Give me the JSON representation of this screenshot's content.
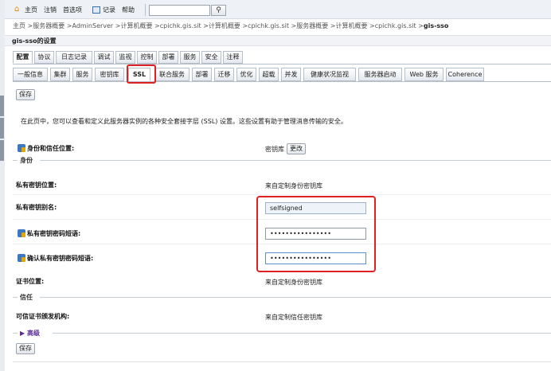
{
  "topbar": {
    "home": "主页",
    "logout": "注销",
    "preferences": "首选项",
    "record": "记录",
    "help": "帮助",
    "search_value": ""
  },
  "breadcrumb": {
    "path": "主页 >服务器概要 >AdminServer >计算机概要 >cpichk.gis.sit >计算机概要 >cpichk.gis.sit >服务器概要 >计算机概要 >cpichk.gis.sit >",
    "current": "gis-sso"
  },
  "page_title": "gis-sso的设置",
  "tabs_primary": [
    {
      "label": "配置",
      "active": true
    },
    {
      "label": "协议",
      "active": false
    },
    {
      "label": "日志记录",
      "active": false
    },
    {
      "label": "调试",
      "active": false
    },
    {
      "label": "监视",
      "active": false
    },
    {
      "label": "控制",
      "active": false
    },
    {
      "label": "部署",
      "active": false
    },
    {
      "label": "服务",
      "active": false
    },
    {
      "label": "安全",
      "active": false
    },
    {
      "label": "注释",
      "active": false
    }
  ],
  "tabs_secondary": [
    {
      "label": "一般信息",
      "active": false
    },
    {
      "label": "集群",
      "active": false
    },
    {
      "label": "服务",
      "active": false
    },
    {
      "label": "密钥库",
      "active": false
    },
    {
      "label": "SSL",
      "active": true
    },
    {
      "label": "联合服务",
      "active": false
    },
    {
      "label": "部署",
      "active": false
    },
    {
      "label": "迁移",
      "active": false
    },
    {
      "label": "优化",
      "active": false
    },
    {
      "label": "超载",
      "active": false
    },
    {
      "label": "并发",
      "active": false
    },
    {
      "label": "健康状况监视",
      "active": false
    },
    {
      "label": "服务器启动",
      "active": false
    },
    {
      "label": "Web 服务",
      "active": false
    },
    {
      "label": "Coherence",
      "active": false
    }
  ],
  "buttons": {
    "save_top": "保存",
    "save_bottom": "保存",
    "change": "更改"
  },
  "intro": "在此页中，您可以查看和定义此服务器实例的各种安全套接字层 (SSL) 设置。这些设置有助于管理消息传输的安全。",
  "identity_trust": {
    "label": "身份和信任位置:",
    "value": "密钥库"
  },
  "sections": {
    "identity": "身份",
    "trust": "信任",
    "advanced": "高级"
  },
  "identity": {
    "private_key_location_label": "私有密钥位置:",
    "private_key_location_value": "来自定制身份密钥库",
    "private_key_alias_label": "私有密钥别名:",
    "private_key_alias_value": "selfsigned",
    "passphrase_label": "私有密钥密码短语:",
    "passphrase_value": "••••••••••••••••",
    "confirm_passphrase_label": "确认私有密钥密码短语:",
    "confirm_passphrase_value": "••••••••••••••••",
    "cert_location_label": "证书位置:",
    "cert_location_value": "来自定制身份密钥库"
  },
  "trust": {
    "trusted_ca_label": "可信证书颁发机构:",
    "trusted_ca_value": "来自定制信任密钥库"
  },
  "colors": {
    "highlight": "#e02020",
    "advanced_link": "#5a2b9a"
  }
}
